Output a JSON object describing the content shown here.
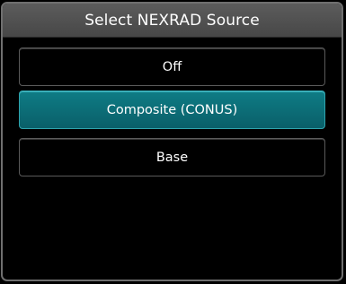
{
  "dialog": {
    "title": "Select NEXRAD Source",
    "selected_index": 1,
    "options": [
      {
        "label": "Off"
      },
      {
        "label": "Composite (CONUS)"
      },
      {
        "label": "Base"
      }
    ]
  },
  "colors": {
    "background": "#000000",
    "title_bar": "#4f4f4f",
    "selected": "#0d6f78",
    "selected_border": "#2ea3ad",
    "border": "#6f6f6f",
    "text": "#ffffff"
  }
}
